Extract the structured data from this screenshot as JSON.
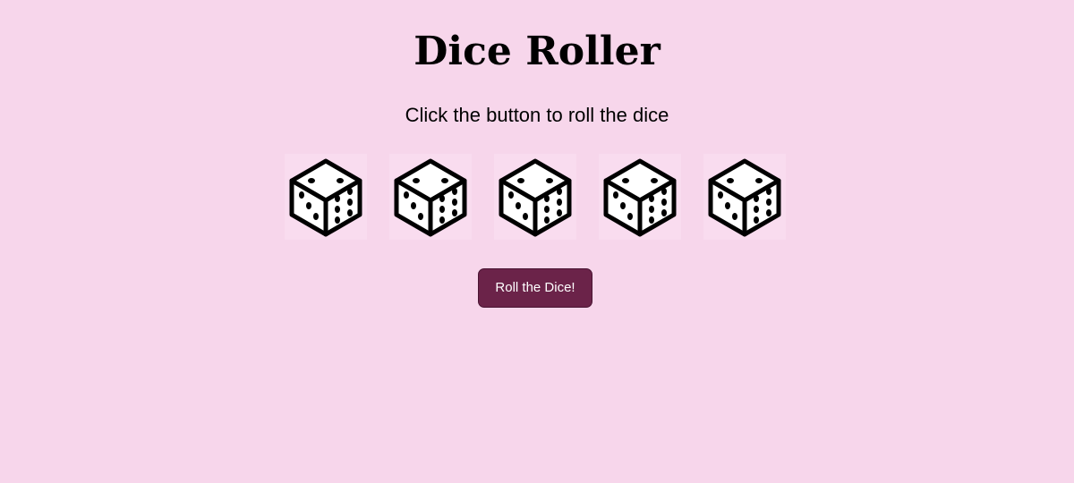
{
  "page": {
    "title": "Dice Roller",
    "subtitle": "Click the button to roll the dice"
  },
  "dice": [
    {
      "icon": "dice-icon"
    },
    {
      "icon": "dice-icon"
    },
    {
      "icon": "dice-icon"
    },
    {
      "icon": "dice-icon"
    },
    {
      "icon": "dice-icon"
    }
  ],
  "actions": {
    "roll_label": "Roll the Dice!"
  },
  "colors": {
    "background": "#f7d6eb",
    "button": "#6b2349",
    "button_text": "#ffffff"
  }
}
